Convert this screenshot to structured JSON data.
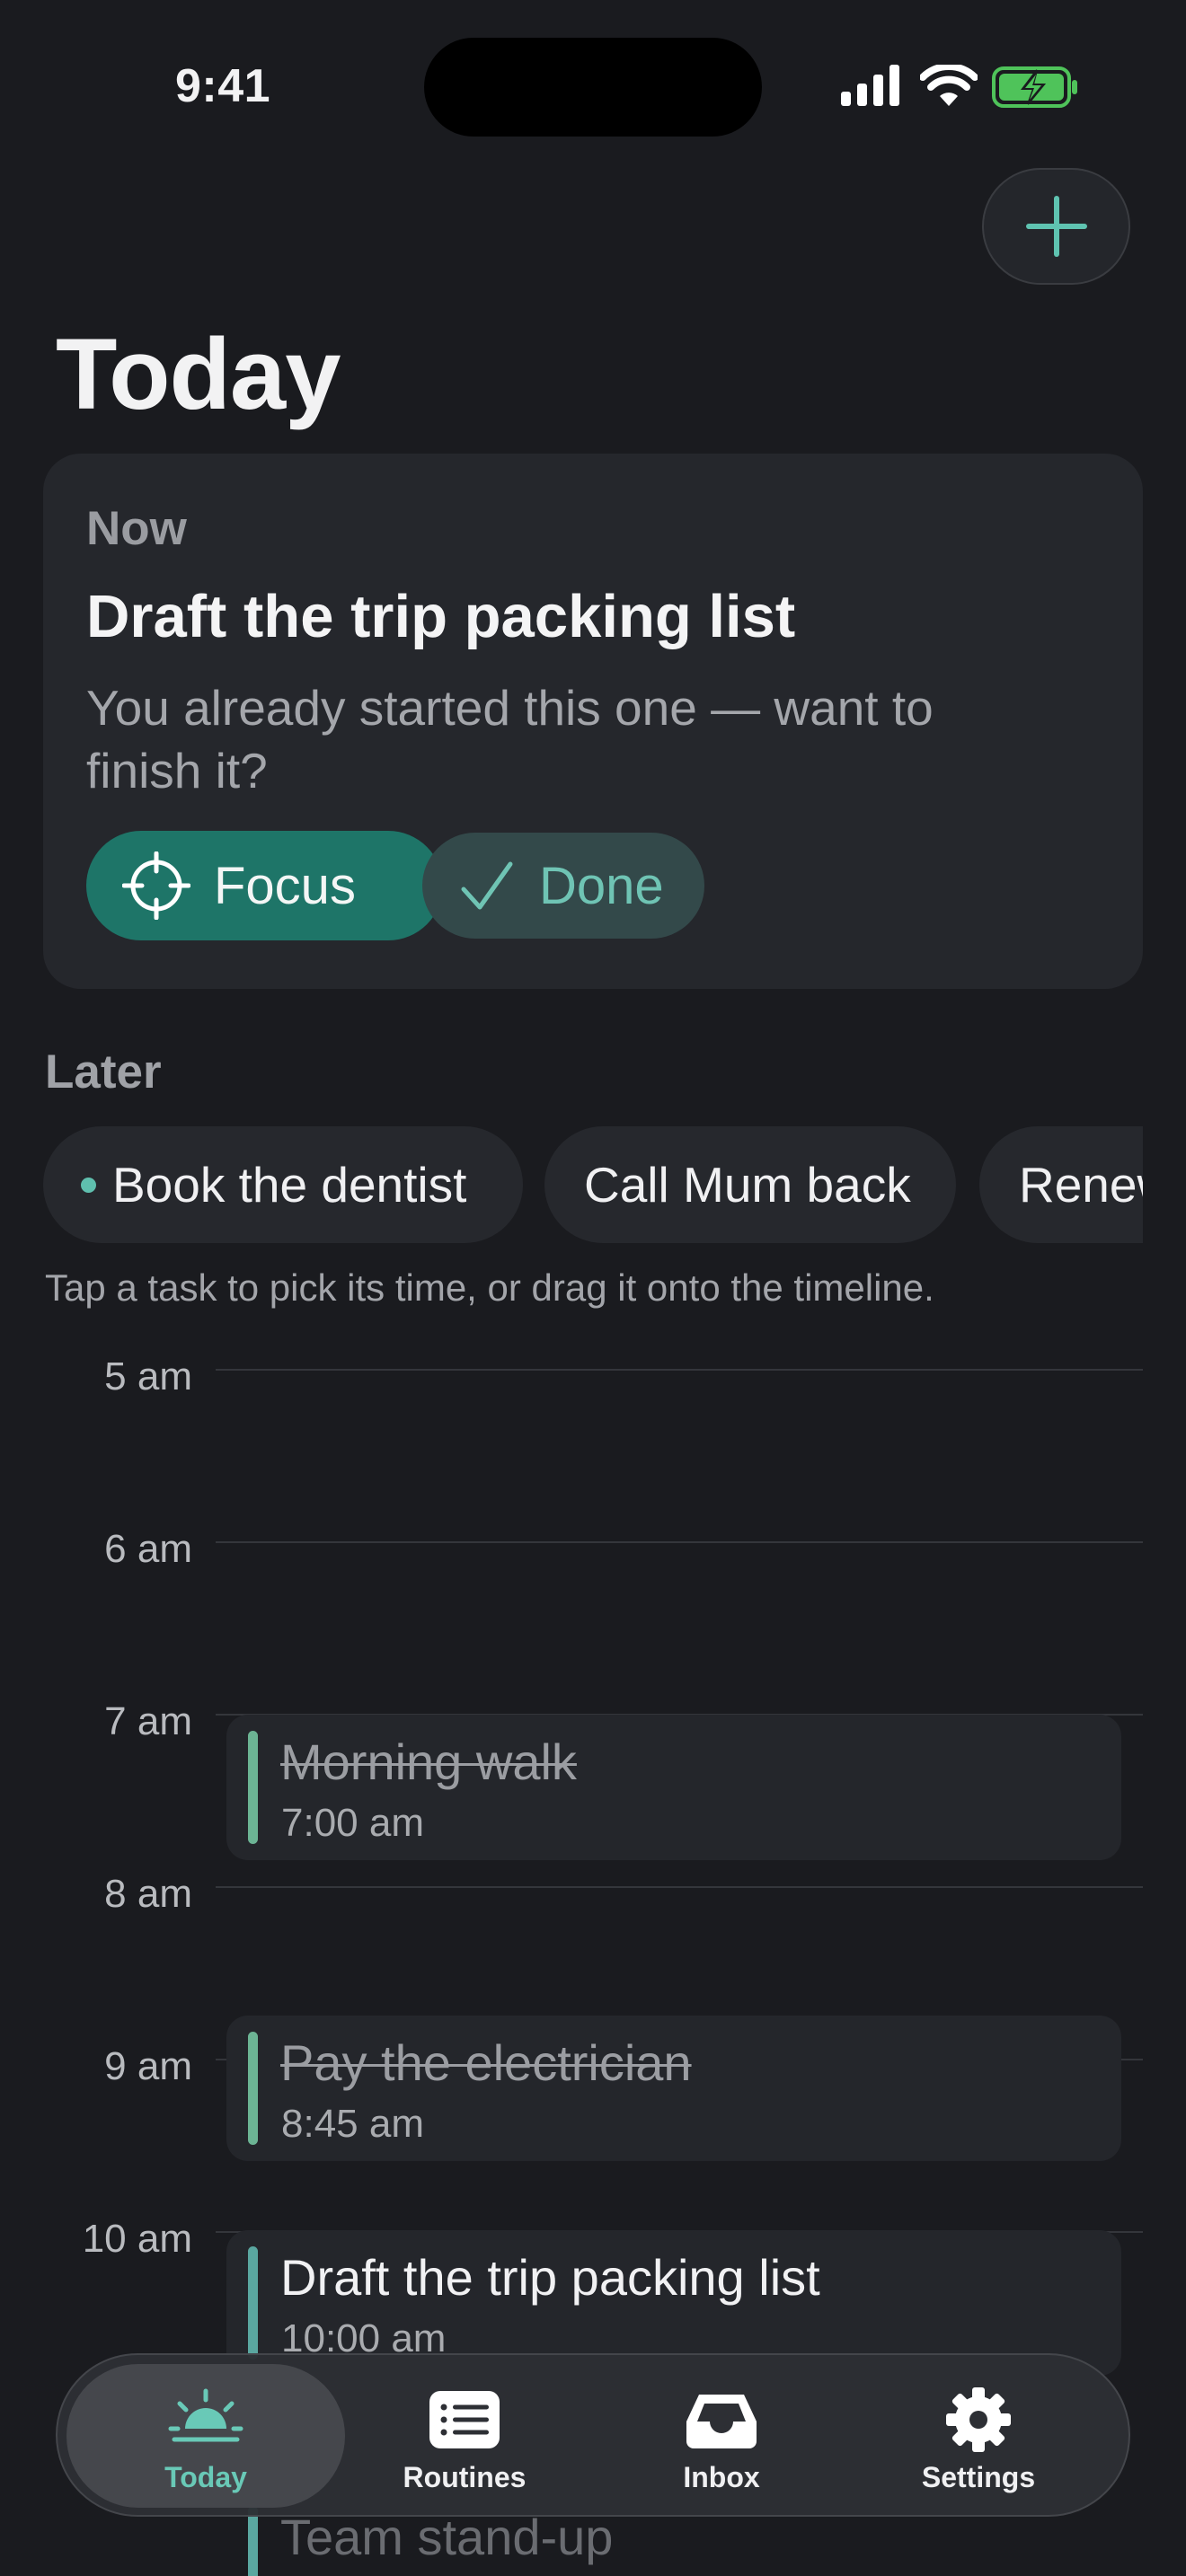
{
  "status_bar": {
    "time": "9:41"
  },
  "header": {
    "title": "Today",
    "add_icon": "plus-icon"
  },
  "now_card": {
    "label": "Now",
    "title": "Draft the trip packing list",
    "subtitle": "You already started this one — want to finish it?",
    "focus_label": "Focus",
    "done_label": "Done"
  },
  "later": {
    "label": "Later",
    "chips": [
      "Book the dentist",
      "Call Mum back",
      "Renew"
    ],
    "hint": "Tap a task to pick its time, or drag it onto the timeline."
  },
  "timeline": {
    "hours": [
      "5 am",
      "6 am",
      "7 am",
      "8 am",
      "9 am",
      "10 am"
    ],
    "events": [
      {
        "title": "Morning walk",
        "time": "7:00 am",
        "done": true
      },
      {
        "title": "Pay the electrician",
        "time": "8:45 am",
        "done": true
      },
      {
        "title": "Draft the trip packing list",
        "time": "10:00 am",
        "done": false
      },
      {
        "title": "Team stand-up",
        "time": "",
        "done": false
      }
    ]
  },
  "tabbar": {
    "tabs": [
      {
        "label": "Today",
        "icon": "sunrise-icon",
        "active": true
      },
      {
        "label": "Routines",
        "icon": "list-icon",
        "active": false
      },
      {
        "label": "Inbox",
        "icon": "inbox-tray-icon",
        "active": false
      },
      {
        "label": "Settings",
        "icon": "gear-icon",
        "active": false
      }
    ]
  },
  "colors": {
    "accent": "#1e7568",
    "accent_text": "#69c9b7",
    "background": "#1a1b1f",
    "card": "#25272c"
  }
}
